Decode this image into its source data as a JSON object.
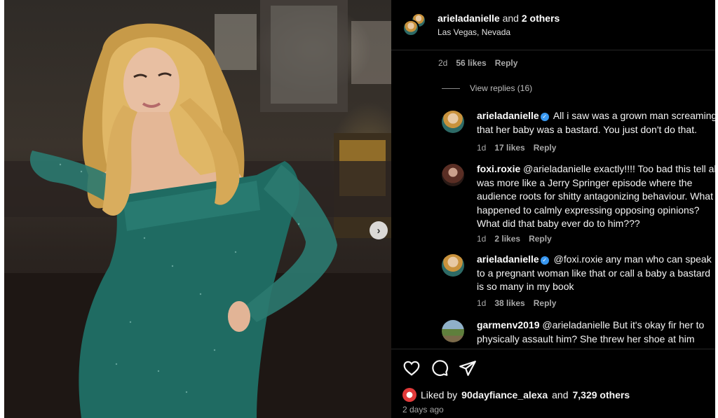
{
  "post": {
    "author": "arieladanielle",
    "collab_joiner": "and",
    "collab_others": "2 others",
    "location": "Las Vegas, Nevada"
  },
  "top_comment_meta": {
    "age": "2d",
    "likes": "56 likes",
    "reply": "Reply"
  },
  "view_replies": "View replies (16)",
  "comments": [
    {
      "user": "arieladanielle",
      "verified": true,
      "text": "All i saw was a grown man screaming that her baby was a bastard. You just don't do that.",
      "age": "1d",
      "likes": "17 likes",
      "reply": "Reply"
    },
    {
      "user": "foxi.roxie",
      "verified": false,
      "text": "@arieladanielle exactly!!!! Too bad this tell all was more like a Jerry Springer episode where the audience roots for shitty antagonizing behaviour. What happened to calmly expressing opposing opinions? What did that baby ever do to him???",
      "age": "1d",
      "likes": "2 likes",
      "reply": "Reply"
    },
    {
      "user": "arieladanielle",
      "verified": true,
      "text": "@foxi.roxie any man who can speak to a pregnant woman like that or call a baby a bastard is so many in my book",
      "age": "1d",
      "likes": "38 likes",
      "reply": "Reply"
    },
    {
      "user": "garmenv2019",
      "verified": false,
      "text": "@arieladanielle But it's okay fir her to physically assault him? She threw her shoe at him BEFORE he even said that!"
    }
  ],
  "actions": {
    "like_icon": "heart-icon",
    "comment_icon": "comment-icon",
    "share_icon": "send-icon"
  },
  "liked_by": {
    "prefix": "Liked by",
    "user": "90dayfiance_alexa",
    "joiner": "and",
    "others": "7,329 others"
  },
  "date": "2 days ago",
  "carousel_next_icon": "chevron-right-icon"
}
